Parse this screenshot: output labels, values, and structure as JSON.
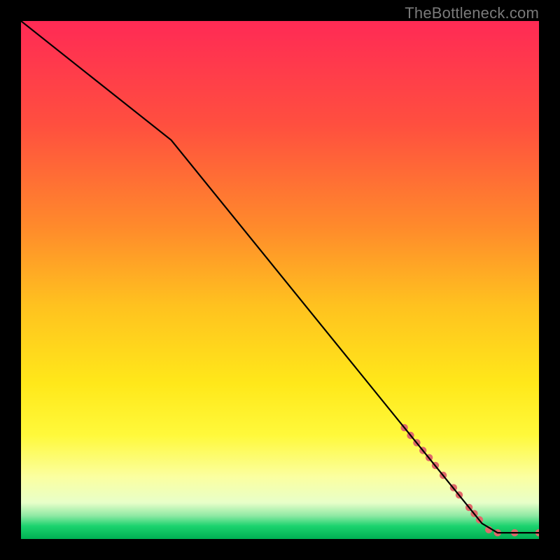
{
  "watermark": "TheBottleneck.com",
  "chart_data": {
    "type": "line",
    "title": "",
    "xlabel": "",
    "ylabel": "",
    "xlim": [
      0,
      100
    ],
    "ylim": [
      0,
      100
    ],
    "gradient_stops": [
      {
        "offset": 0.0,
        "color": "#ff2a55"
      },
      {
        "offset": 0.2,
        "color": "#ff4f3f"
      },
      {
        "offset": 0.4,
        "color": "#ff8b2b"
      },
      {
        "offset": 0.55,
        "color": "#ffc21f"
      },
      {
        "offset": 0.7,
        "color": "#ffe81a"
      },
      {
        "offset": 0.8,
        "color": "#fff93b"
      },
      {
        "offset": 0.88,
        "color": "#fbffa0"
      },
      {
        "offset": 0.93,
        "color": "#e8ffc9"
      },
      {
        "offset": 0.955,
        "color": "#8fe9a4"
      },
      {
        "offset": 0.975,
        "color": "#1bd36e"
      },
      {
        "offset": 1.0,
        "color": "#00b053"
      }
    ],
    "series": [
      {
        "name": "bottleneck-curve",
        "color": "#000000",
        "points": [
          {
            "x": 0.0,
            "y": 100.0
          },
          {
            "x": 29.0,
            "y": 77.0
          },
          {
            "x": 89.0,
            "y": 3.0
          },
          {
            "x": 92.0,
            "y": 1.2
          },
          {
            "x": 100.0,
            "y": 1.2
          }
        ]
      }
    ],
    "markers": [
      {
        "x": 74.0,
        "y": 21.5,
        "r": 5.2
      },
      {
        "x": 75.2,
        "y": 20.0,
        "r": 5.2
      },
      {
        "x": 76.4,
        "y": 18.6,
        "r": 5.2
      },
      {
        "x": 77.6,
        "y": 17.1,
        "r": 5.2
      },
      {
        "x": 78.8,
        "y": 15.7,
        "r": 5.2
      },
      {
        "x": 80.0,
        "y": 14.2,
        "r": 5.2
      },
      {
        "x": 81.5,
        "y": 12.3,
        "r": 5.2
      },
      {
        "x": 83.5,
        "y": 9.9,
        "r": 5.2
      },
      {
        "x": 84.6,
        "y": 8.5,
        "r": 5.2
      },
      {
        "x": 86.5,
        "y": 6.1,
        "r": 5.2
      },
      {
        "x": 87.5,
        "y": 4.9,
        "r": 5.2
      },
      {
        "x": 88.5,
        "y": 3.7,
        "r": 5.2
      },
      {
        "x": 90.3,
        "y": 1.8,
        "r": 5.2
      },
      {
        "x": 92.0,
        "y": 1.2,
        "r": 5.2
      },
      {
        "x": 95.3,
        "y": 1.2,
        "r": 5.2
      },
      {
        "x": 100.0,
        "y": 1.2,
        "r": 5.2
      }
    ],
    "marker_color": "#e06a6a"
  }
}
